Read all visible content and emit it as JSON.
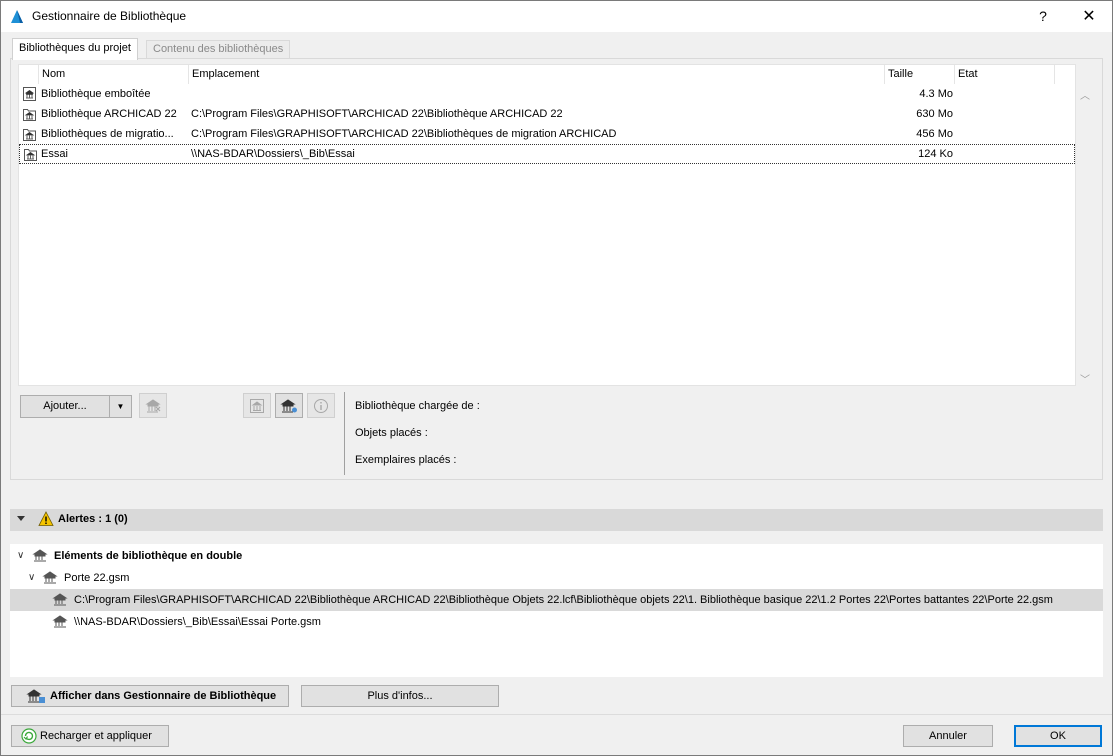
{
  "window": {
    "title": "Gestionnaire de Bibliothèque",
    "help": "?",
    "close": "✕"
  },
  "tabs": [
    {
      "label": "Bibliothèques du projet",
      "active": true
    },
    {
      "label": "Contenu des bibliothèques",
      "active": false
    }
  ],
  "list": {
    "columns": [
      "Nom",
      "Emplacement",
      "Taille",
      "Etat"
    ],
    "rows": [
      {
        "name": "Bibliothèque emboîtée",
        "location": "",
        "size": "4.3 Mo",
        "status": ""
      },
      {
        "name": "Bibliothèque ARCHICAD 22",
        "location": "C:\\Program Files\\GRAPHISOFT\\ARCHICAD 22\\Bibliothèque ARCHICAD 22",
        "size": "630 Mo",
        "status": ""
      },
      {
        "name": "Bibliothèques de migratio...",
        "location": "C:\\Program Files\\GRAPHISOFT\\ARCHICAD 22\\Bibliothèques de migration ARCHICAD",
        "size": "456 Mo",
        "status": ""
      },
      {
        "name": "Essai",
        "location": "\\\\NAS-BDAR\\Dossiers\\_Bib\\Essai",
        "size": "124 Ko",
        "status": ""
      }
    ]
  },
  "controls": {
    "add_label": "Ajouter...",
    "dropdown_arrow": "▼"
  },
  "info": {
    "loaded_from": "Bibliothèque chargée de :",
    "placed_objects": "Objets placés :",
    "placed_instances": "Exemplaires placés :"
  },
  "alerts": {
    "title": "Alertes : 1 (0)",
    "tree": {
      "group": "Eléments de bibliothèque en double",
      "item": "Porte 22.gsm",
      "paths": [
        "C:\\Program Files\\GRAPHISOFT\\ARCHICAD 22\\Bibliothèque ARCHICAD 22\\Bibliothèque Objets 22.lcf\\Bibliothèque objets 22\\1. Bibliothèque basique 22\\1.2 Portes 22\\Portes battantes 22\\Porte 22.gsm",
        "\\\\NAS-BDAR\\Dossiers\\_Bib\\Essai\\Essai Porte.gsm"
      ]
    }
  },
  "buttons": {
    "show_in_manager": "Afficher dans Gestionnaire de Bibliothèque",
    "more_info": "Plus d'infos...",
    "reload": "Recharger et appliquer",
    "cancel": "Annuler",
    "ok": "OK"
  },
  "colors": {
    "accent": "#0078d7",
    "warning": "#f5c400",
    "reload_green": "#3aa83a"
  }
}
